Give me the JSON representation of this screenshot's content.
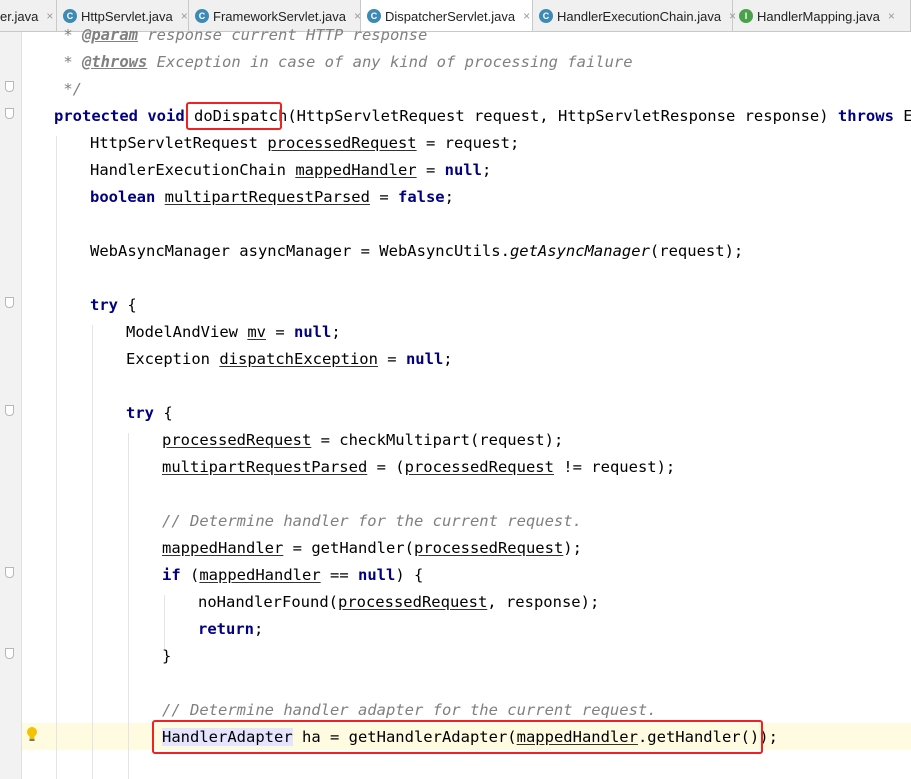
{
  "tabs": [
    {
      "name": "er.java",
      "icon": "",
      "active": false
    },
    {
      "name": "HttpServlet.java",
      "icon": "C",
      "active": false
    },
    {
      "name": "FrameworkServlet.java",
      "icon": "C",
      "active": false
    },
    {
      "name": "DispatcherServlet.java",
      "icon": "C",
      "active": true
    },
    {
      "name": "HandlerExecutionChain.java",
      "icon": "C",
      "active": false
    },
    {
      "name": "HandlerMapping.java",
      "icon": "I",
      "active": false
    }
  ],
  "tab_close_glyph": "×",
  "colors": {
    "keyword": "#000080",
    "comment": "#808080",
    "highlight_box": "#e22222",
    "class_icon": "#3d8bb5",
    "interface_icon": "#4aa14a"
  },
  "code": {
    "l1": {
      "prefix": "* ",
      "tag": "@param",
      "rest": " response current HTTP response"
    },
    "l2": {
      "prefix": "* ",
      "tag": "@throws",
      "rest": " Exception in case of any kind of processing failure"
    },
    "l3": {
      "text": "*/"
    },
    "l4": {
      "kw1": "protected",
      "kw2": "void",
      "method": "doDispatch",
      "params": "(HttpServletRequest request, HttpServletResponse response) ",
      "kw3": "throws",
      "rest": " Excep"
    },
    "l5": {
      "type": "HttpServletRequest ",
      "var": "processedRequest",
      "rest": " = request;"
    },
    "l6": {
      "type": "HandlerExecutionChain ",
      "var": "mappedHandler",
      "mid": " = ",
      "kw": "null",
      "end": ";"
    },
    "l7": {
      "kw": "boolean",
      "sp": " ",
      "var": "multipartRequestParsed",
      "mid": " = ",
      "kw2": "false",
      "end": ";"
    },
    "l8": {
      "a": "WebAsyncManager asyncManager = WebAsyncUtils.",
      "it": "getAsyncManager",
      "b": "(request);"
    },
    "l9": {
      "kw": "try",
      "rest": " {"
    },
    "l10": {
      "type": "ModelAndView ",
      "var": "mv",
      "mid": " = ",
      "kw": "null",
      "end": ";"
    },
    "l11": {
      "type": "Exception ",
      "var": "dispatchException",
      "mid": " = ",
      "kw": "null",
      "end": ";"
    },
    "l12": {
      "kw": "try",
      "rest": " {"
    },
    "l13": {
      "var": "processedRequest",
      "rest": " = checkMultipart(request);"
    },
    "l14": {
      "var": "multipartRequestParsed",
      "a": " = (",
      "var2": "processedRequest",
      "b": " != request);"
    },
    "l15": {
      "text": "// Determine handler for the current request."
    },
    "l16": {
      "var": "mappedHandler",
      "a": " = getHandler(",
      "var2": "processedRequest",
      "b": ");"
    },
    "l17": {
      "kw": "if",
      "a": " (",
      "var": "mappedHandler",
      "b": " == ",
      "kw2": "null",
      "c": ") {"
    },
    "l18": {
      "a": "noHandlerFound(",
      "var": "processedRequest",
      "b": ", response);"
    },
    "l19": {
      "kw": "return",
      "end": ";"
    },
    "l20": {
      "text": "}"
    },
    "l21": {
      "text": "// Determine handler adapter for the current request."
    },
    "l22": {
      "type": "HandlerAdapter",
      "a": " ha = getHandlerAdapter(",
      "var": "mappedHandler",
      "b": ".getHandler());"
    }
  }
}
